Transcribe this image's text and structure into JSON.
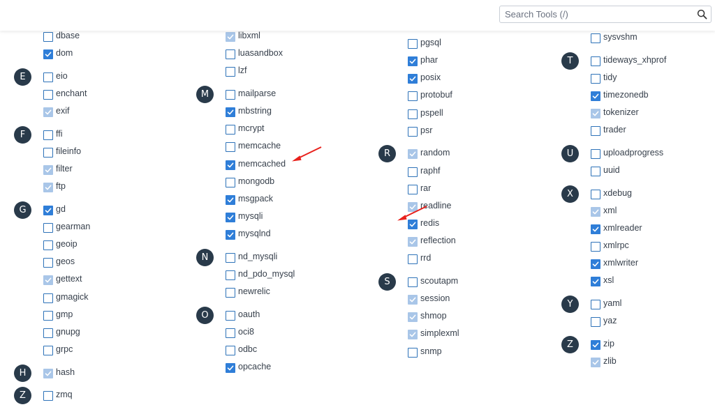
{
  "search": {
    "placeholder": "Search Tools (/)",
    "value": ""
  },
  "columns": [
    {
      "groups": [
        {
          "letter": "",
          "items": [
            {
              "label": "dbase",
              "state": "unchecked"
            },
            {
              "label": "dom",
              "state": "checked"
            }
          ]
        },
        {
          "letter": "E",
          "items": [
            {
              "label": "eio",
              "state": "unchecked"
            },
            {
              "label": "enchant",
              "state": "unchecked"
            },
            {
              "label": "exif",
              "state": "disabled"
            }
          ]
        },
        {
          "letter": "F",
          "items": [
            {
              "label": "ffi",
              "state": "unchecked"
            },
            {
              "label": "fileinfo",
              "state": "unchecked"
            },
            {
              "label": "filter",
              "state": "disabled"
            },
            {
              "label": "ftp",
              "state": "disabled"
            }
          ]
        },
        {
          "letter": "G",
          "items": [
            {
              "label": "gd",
              "state": "checked"
            },
            {
              "label": "gearman",
              "state": "unchecked"
            },
            {
              "label": "geoip",
              "state": "unchecked"
            },
            {
              "label": "geos",
              "state": "unchecked"
            },
            {
              "label": "gettext",
              "state": "disabled"
            },
            {
              "label": "gmagick",
              "state": "unchecked"
            },
            {
              "label": "gmp",
              "state": "unchecked"
            },
            {
              "label": "gnupg",
              "state": "unchecked"
            },
            {
              "label": "grpc",
              "state": "unchecked"
            }
          ]
        },
        {
          "letter": "H",
          "items": [
            {
              "label": "hash",
              "state": "disabled"
            }
          ]
        },
        {
          "letter": "Z",
          "items": [
            {
              "label": "zmq",
              "state": "unchecked"
            }
          ]
        }
      ]
    },
    {
      "groups": [
        {
          "letter": "",
          "items": [
            {
              "label": "libxml",
              "state": "disabled"
            },
            {
              "label": "luasandbox",
              "state": "unchecked"
            },
            {
              "label": "lzf",
              "state": "unchecked"
            }
          ]
        },
        {
          "letter": "M",
          "items": [
            {
              "label": "mailparse",
              "state": "unchecked"
            },
            {
              "label": "mbstring",
              "state": "checked"
            },
            {
              "label": "mcrypt",
              "state": "unchecked"
            },
            {
              "label": "memcache",
              "state": "unchecked"
            },
            {
              "label": "memcached",
              "state": "checked"
            },
            {
              "label": "mongodb",
              "state": "unchecked"
            },
            {
              "label": "msgpack",
              "state": "checked"
            },
            {
              "label": "mysqli",
              "state": "checked"
            },
            {
              "label": "mysqlnd",
              "state": "checked"
            }
          ]
        },
        {
          "letter": "N",
          "items": [
            {
              "label": "nd_mysqli",
              "state": "unchecked"
            },
            {
              "label": "nd_pdo_mysql",
              "state": "unchecked"
            },
            {
              "label": "newrelic",
              "state": "unchecked"
            }
          ]
        },
        {
          "letter": "O",
          "items": [
            {
              "label": "oauth",
              "state": "unchecked"
            },
            {
              "label": "oci8",
              "state": "unchecked"
            },
            {
              "label": "odbc",
              "state": "unchecked"
            },
            {
              "label": "opcache",
              "state": "checked"
            }
          ]
        }
      ]
    },
    {
      "groups": [
        {
          "letter": "",
          "items": [
            {
              "label": "pgsql",
              "state": "unchecked"
            },
            {
              "label": "phar",
              "state": "checked"
            },
            {
              "label": "posix",
              "state": "checked"
            },
            {
              "label": "protobuf",
              "state": "unchecked"
            },
            {
              "label": "pspell",
              "state": "unchecked"
            },
            {
              "label": "psr",
              "state": "unchecked"
            }
          ]
        },
        {
          "letter": "R",
          "items": [
            {
              "label": "random",
              "state": "disabled"
            },
            {
              "label": "raphf",
              "state": "unchecked"
            },
            {
              "label": "rar",
              "state": "unchecked"
            },
            {
              "label": "readline",
              "state": "disabled"
            },
            {
              "label": "redis",
              "state": "checked"
            },
            {
              "label": "reflection",
              "state": "disabled"
            },
            {
              "label": "rrd",
              "state": "unchecked"
            }
          ]
        },
        {
          "letter": "S",
          "items": [
            {
              "label": "scoutapm",
              "state": "unchecked"
            },
            {
              "label": "session",
              "state": "disabled"
            },
            {
              "label": "shmop",
              "state": "disabled"
            },
            {
              "label": "simplexml",
              "state": "disabled"
            },
            {
              "label": "snmp",
              "state": "unchecked"
            }
          ]
        }
      ]
    },
    {
      "groups": [
        {
          "letter": "",
          "items": [
            {
              "label": "sysvshm",
              "state": "unchecked"
            }
          ]
        },
        {
          "letter": "T",
          "items": [
            {
              "label": "tideways_xhprof",
              "state": "unchecked"
            },
            {
              "label": "tidy",
              "state": "unchecked"
            },
            {
              "label": "timezonedb",
              "state": "checked"
            },
            {
              "label": "tokenizer",
              "state": "disabled"
            },
            {
              "label": "trader",
              "state": "unchecked"
            }
          ]
        },
        {
          "letter": "U",
          "items": [
            {
              "label": "uploadprogress",
              "state": "unchecked"
            },
            {
              "label": "uuid",
              "state": "unchecked"
            }
          ]
        },
        {
          "letter": "X",
          "items": [
            {
              "label": "xdebug",
              "state": "unchecked"
            },
            {
              "label": "xml",
              "state": "disabled"
            },
            {
              "label": "xmlreader",
              "state": "checked"
            },
            {
              "label": "xmlrpc",
              "state": "unchecked"
            },
            {
              "label": "xmlwriter",
              "state": "checked"
            },
            {
              "label": "xsl",
              "state": "checked"
            }
          ]
        },
        {
          "letter": "Y",
          "items": [
            {
              "label": "yaml",
              "state": "unchecked"
            },
            {
              "label": "yaz",
              "state": "unchecked"
            }
          ]
        },
        {
          "letter": "Z",
          "items": [
            {
              "label": "zip",
              "state": "checked"
            },
            {
              "label": "zlib",
              "state": "disabled"
            }
          ]
        }
      ]
    }
  ],
  "annotations": [
    {
      "target": "memcached",
      "icon": "red-arrow-icon",
      "color": "#e8211c"
    },
    {
      "target": "redis",
      "icon": "red-arrow-icon",
      "color": "#e8211c"
    }
  ],
  "colors": {
    "badge": "#293a4a",
    "checkbox_checked": "#2f7ed8",
    "checkbox_disabled": "#a9c6e8",
    "checkbox_border": "#2d72b8"
  }
}
